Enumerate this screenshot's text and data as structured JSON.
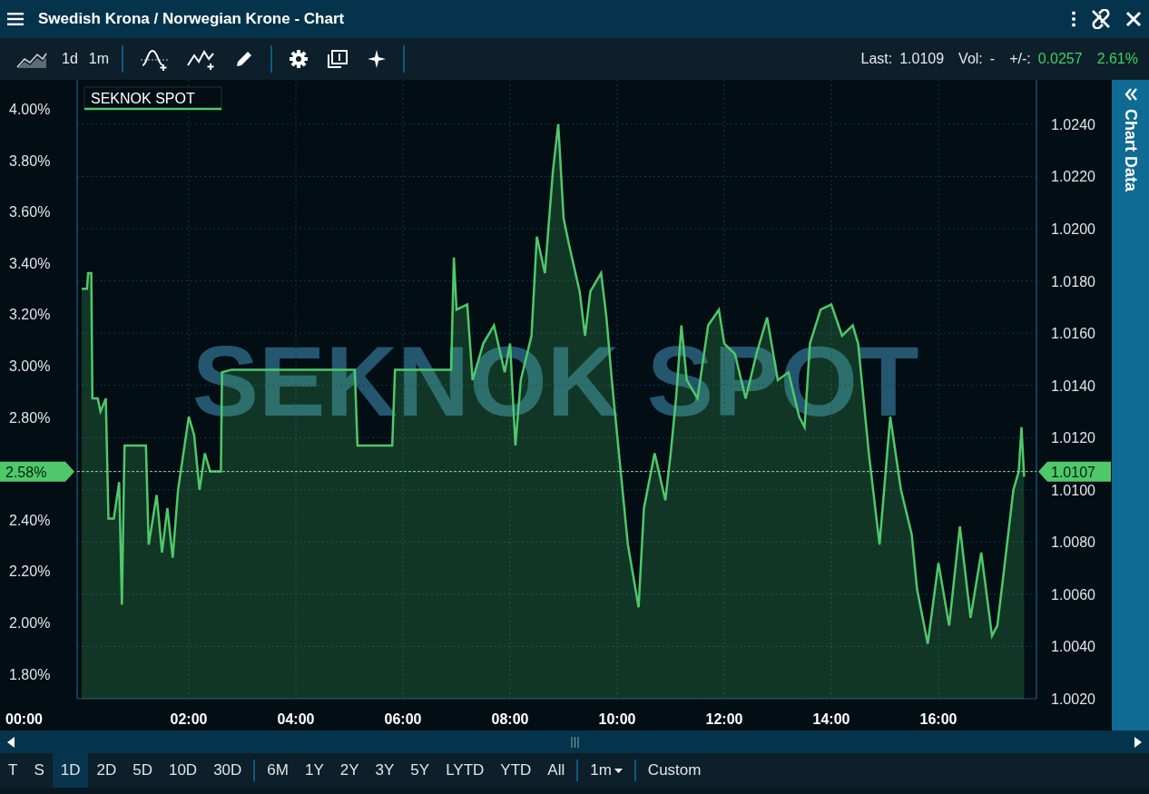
{
  "window": {
    "title": "Swedish Krona / Norwegian Krone - Chart"
  },
  "toolbar": {
    "items": [
      {
        "kind": "icon"
      },
      {
        "kind": "text",
        "label": "1d"
      },
      {
        "kind": "text",
        "label": "1m"
      },
      {
        "kind": "separator"
      },
      {
        "kind": "icon"
      },
      {
        "kind": "icon"
      },
      {
        "kind": "icon"
      },
      {
        "kind": "separator"
      },
      {
        "kind": "icon"
      },
      {
        "kind": "icon"
      },
      {
        "kind": "icon"
      },
      {
        "kind": "separator"
      }
    ],
    "stats": [
      {
        "label": "Last:",
        "value": "1.0109",
        "positive": false
      },
      {
        "label": "Vol:",
        "value": "-",
        "positive": false
      },
      {
        "label": "+/-:",
        "value": "0.0257",
        "positive": true
      },
      {
        "value": "2.61%",
        "positive": true
      }
    ]
  },
  "chart": {
    "watermark": "SEKNOK SPOT",
    "left_ticks": [
      "4.00%",
      "3.80%",
      "3.60%",
      "3.40%",
      "3.20%",
      "3.00%",
      "2.80%",
      "2.40%",
      "2.20%",
      "2.00%",
      "1.80%"
    ],
    "left_current": "2.58%",
    "x_start_label": "00:00",
    "side_tab": "Chart Data",
    "chart_data": {
      "type": "area",
      "grid": true,
      "xlim": [
        -0.085,
        17.83
      ],
      "ylim": [
        1.002,
        1.0257
      ],
      "xticks": [
        {
          "value": 2,
          "label": "02:00"
        },
        {
          "value": 4,
          "label": "04:00"
        },
        {
          "value": 6,
          "label": "06:00"
        },
        {
          "value": 8,
          "label": "08:00"
        },
        {
          "value": 10,
          "label": "10:00"
        },
        {
          "value": 12,
          "label": "12:00"
        },
        {
          "value": 14,
          "label": "14:00"
        },
        {
          "value": 16,
          "label": "16:00"
        }
      ],
      "yticks": [
        {
          "value": 1.024,
          "label": "1.0240"
        },
        {
          "value": 1.022,
          "label": "1.0220"
        },
        {
          "value": 1.02,
          "label": "1.0200"
        },
        {
          "value": 1.018,
          "label": "1.0180"
        },
        {
          "value": 1.016,
          "label": "1.0160"
        },
        {
          "value": 1.014,
          "label": "1.0140"
        },
        {
          "value": 1.012,
          "label": "1.0120"
        },
        {
          "value": 1.01,
          "label": "1.0100"
        },
        {
          "value": 1.008,
          "label": "1.0080"
        },
        {
          "value": 1.006,
          "label": "1.0060"
        },
        {
          "value": 1.004,
          "label": "1.0040"
        },
        {
          "value": 1.002,
          "label": "1.0020"
        }
      ],
      "x": [
        0,
        0.1,
        0.12,
        0.18,
        0.2,
        0.3,
        0.35,
        0.45,
        0.5,
        0.6,
        0.7,
        0.75,
        0.8,
        1.2,
        1.25,
        1.4,
        1.5,
        1.6,
        1.7,
        1.8,
        2.0,
        2.1,
        2.2,
        2.3,
        2.4,
        2.6,
        2.62,
        2.8,
        5.1,
        5.15,
        5.8,
        5.85,
        6.9,
        6.95,
        7.0,
        7.2,
        7.3,
        7.5,
        7.7,
        7.9,
        8.0,
        8.1,
        8.2,
        8.4,
        8.5,
        8.65,
        8.8,
        8.9,
        9.0,
        9.1,
        9.3,
        9.4,
        9.5,
        9.7,
        9.8,
        9.9,
        10.0,
        10.2,
        10.4,
        10.5,
        10.7,
        10.9,
        11.0,
        11.1,
        11.2,
        11.3,
        11.5,
        11.7,
        11.9,
        12.0,
        12.2,
        12.4,
        12.6,
        12.8,
        13.0,
        13.2,
        13.4,
        13.5,
        13.6,
        13.8,
        14.0,
        14.2,
        14.4,
        14.5,
        14.7,
        14.9,
        15.1,
        15.3,
        15.5,
        15.6,
        15.8,
        16.0,
        16.2,
        16.4,
        16.6,
        16.8,
        17.0,
        17.1,
        17.2,
        17.4,
        17.5,
        17.55,
        17.6
      ],
      "series": [
        {
          "name": "SEKNOK SPOT",
          "color": "#4fc86a",
          "values": [
            1.0177,
            1.0177,
            1.0183,
            1.0183,
            1.0135,
            1.0135,
            1.013,
            1.0135,
            1.0089,
            1.0089,
            1.0103,
            1.0056,
            1.0117,
            1.0117,
            1.0079,
            1.0098,
            1.0076,
            1.0093,
            1.0074,
            1.01,
            1.0128,
            1.0121,
            1.01,
            1.0114,
            1.0107,
            1.0107,
            1.0145,
            1.0146,
            1.0146,
            1.0117,
            1.0117,
            1.0146,
            1.0146,
            1.0189,
            1.0169,
            1.0171,
            1.0142,
            1.0156,
            1.0163,
            1.0145,
            1.0156,
            1.0117,
            1.0142,
            1.0159,
            1.0197,
            1.0183,
            1.0222,
            1.024,
            1.0204,
            1.0194,
            1.0176,
            1.0159,
            1.0176,
            1.0183,
            1.0166,
            1.0142,
            1.0121,
            1.0079,
            1.0055,
            1.0093,
            1.0114,
            1.0096,
            1.0114,
            1.0135,
            1.0163,
            1.0142,
            1.0135,
            1.0163,
            1.0169,
            1.0156,
            1.0152,
            1.0135,
            1.0152,
            1.0166,
            1.0142,
            1.0145,
            1.0128,
            1.0124,
            1.0156,
            1.0169,
            1.0171,
            1.0159,
            1.0163,
            1.0156,
            1.0114,
            1.0079,
            1.0128,
            1.01,
            1.0083,
            1.0062,
            1.0041,
            1.0072,
            1.0048,
            1.0086,
            1.0051,
            1.0076,
            1.0044,
            1.0048,
            1.0065,
            1.01,
            1.0107,
            1.0124,
            1.0105
          ]
        }
      ],
      "ref_lines": [
        {
          "axis": "y",
          "value": 1.0107,
          "label": "1.0107"
        }
      ]
    }
  },
  "range_groups": [
    [
      {
        "label": "T",
        "selected": false
      },
      {
        "label": "S",
        "selected": false
      },
      {
        "label": "1D",
        "selected": true
      },
      {
        "label": "2D",
        "selected": false
      },
      {
        "label": "5D",
        "selected": false
      },
      {
        "label": "10D",
        "selected": false
      },
      {
        "label": "30D",
        "selected": false
      }
    ],
    [
      {
        "label": "6M",
        "selected": false
      },
      {
        "label": "1Y",
        "selected": false
      },
      {
        "label": "2Y",
        "selected": false
      },
      {
        "label": "3Y",
        "selected": false
      },
      {
        "label": "5Y",
        "selected": false
      },
      {
        "label": "LYTD",
        "selected": false
      },
      {
        "label": "YTD",
        "selected": false
      },
      {
        "label": "All",
        "selected": false
      }
    ],
    [
      {
        "label": "1m",
        "selected": false,
        "kind": "dropdown"
      }
    ],
    [
      {
        "label": "Custom",
        "selected": false
      }
    ]
  ]
}
